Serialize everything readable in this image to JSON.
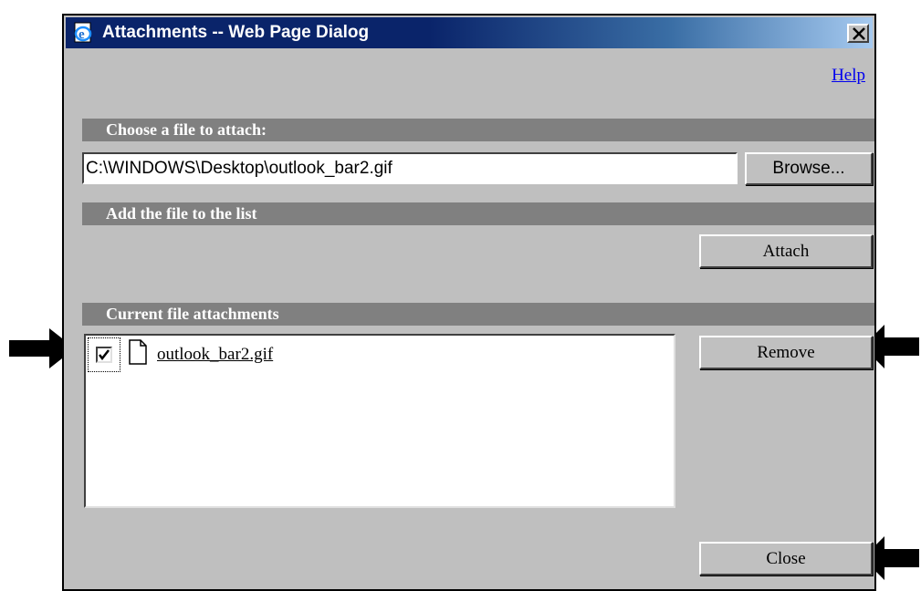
{
  "window": {
    "title": "Attachments -- Web Page Dialog",
    "app_icon": "ie-page-icon",
    "close_icon": "close-x-icon"
  },
  "help_link": "Help",
  "sections": {
    "choose": "Choose a file to attach:",
    "add": "Add the file to the list",
    "current": "Current file attachments"
  },
  "file_input": {
    "value": "C:\\WINDOWS\\Desktop\\outlook_bar2.gif"
  },
  "buttons": {
    "browse": "Browse...",
    "attach": "Attach",
    "remove": "Remove",
    "close": "Close"
  },
  "attachments": [
    {
      "name": "outlook_bar2.gif",
      "checked": true,
      "icon": "document-icon"
    }
  ],
  "colors": {
    "title_bar": "#0a246a",
    "dialog_bg": "#bfbfbf",
    "section_bar": "#808080",
    "link": "#0000ee"
  }
}
